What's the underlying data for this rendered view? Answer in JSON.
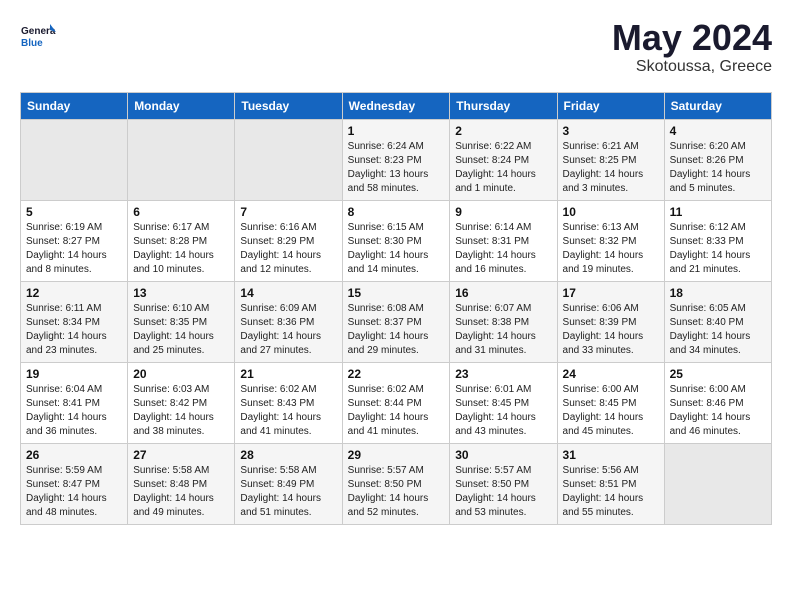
{
  "header": {
    "logo_line1": "General",
    "logo_line2": "Blue",
    "month_year": "May 2024",
    "location": "Skotoussa, Greece"
  },
  "days_of_week": [
    "Sunday",
    "Monday",
    "Tuesday",
    "Wednesday",
    "Thursday",
    "Friday",
    "Saturday"
  ],
  "weeks": [
    [
      {
        "day": "",
        "info": ""
      },
      {
        "day": "",
        "info": ""
      },
      {
        "day": "",
        "info": ""
      },
      {
        "day": "1",
        "info": "Sunrise: 6:24 AM\nSunset: 8:23 PM\nDaylight: 13 hours\nand 58 minutes."
      },
      {
        "day": "2",
        "info": "Sunrise: 6:22 AM\nSunset: 8:24 PM\nDaylight: 14 hours\nand 1 minute."
      },
      {
        "day": "3",
        "info": "Sunrise: 6:21 AM\nSunset: 8:25 PM\nDaylight: 14 hours\nand 3 minutes."
      },
      {
        "day": "4",
        "info": "Sunrise: 6:20 AM\nSunset: 8:26 PM\nDaylight: 14 hours\nand 5 minutes."
      }
    ],
    [
      {
        "day": "5",
        "info": "Sunrise: 6:19 AM\nSunset: 8:27 PM\nDaylight: 14 hours\nand 8 minutes."
      },
      {
        "day": "6",
        "info": "Sunrise: 6:17 AM\nSunset: 8:28 PM\nDaylight: 14 hours\nand 10 minutes."
      },
      {
        "day": "7",
        "info": "Sunrise: 6:16 AM\nSunset: 8:29 PM\nDaylight: 14 hours\nand 12 minutes."
      },
      {
        "day": "8",
        "info": "Sunrise: 6:15 AM\nSunset: 8:30 PM\nDaylight: 14 hours\nand 14 minutes."
      },
      {
        "day": "9",
        "info": "Sunrise: 6:14 AM\nSunset: 8:31 PM\nDaylight: 14 hours\nand 16 minutes."
      },
      {
        "day": "10",
        "info": "Sunrise: 6:13 AM\nSunset: 8:32 PM\nDaylight: 14 hours\nand 19 minutes."
      },
      {
        "day": "11",
        "info": "Sunrise: 6:12 AM\nSunset: 8:33 PM\nDaylight: 14 hours\nand 21 minutes."
      }
    ],
    [
      {
        "day": "12",
        "info": "Sunrise: 6:11 AM\nSunset: 8:34 PM\nDaylight: 14 hours\nand 23 minutes."
      },
      {
        "day": "13",
        "info": "Sunrise: 6:10 AM\nSunset: 8:35 PM\nDaylight: 14 hours\nand 25 minutes."
      },
      {
        "day": "14",
        "info": "Sunrise: 6:09 AM\nSunset: 8:36 PM\nDaylight: 14 hours\nand 27 minutes."
      },
      {
        "day": "15",
        "info": "Sunrise: 6:08 AM\nSunset: 8:37 PM\nDaylight: 14 hours\nand 29 minutes."
      },
      {
        "day": "16",
        "info": "Sunrise: 6:07 AM\nSunset: 8:38 PM\nDaylight: 14 hours\nand 31 minutes."
      },
      {
        "day": "17",
        "info": "Sunrise: 6:06 AM\nSunset: 8:39 PM\nDaylight: 14 hours\nand 33 minutes."
      },
      {
        "day": "18",
        "info": "Sunrise: 6:05 AM\nSunset: 8:40 PM\nDaylight: 14 hours\nand 34 minutes."
      }
    ],
    [
      {
        "day": "19",
        "info": "Sunrise: 6:04 AM\nSunset: 8:41 PM\nDaylight: 14 hours\nand 36 minutes."
      },
      {
        "day": "20",
        "info": "Sunrise: 6:03 AM\nSunset: 8:42 PM\nDaylight: 14 hours\nand 38 minutes."
      },
      {
        "day": "21",
        "info": "Sunrise: 6:02 AM\nSunset: 8:43 PM\nDaylight: 14 hours\nand 41 minutes."
      },
      {
        "day": "22",
        "info": "Sunrise: 6:02 AM\nSunset: 8:44 PM\nDaylight: 14 hours\nand 41 minutes."
      },
      {
        "day": "23",
        "info": "Sunrise: 6:01 AM\nSunset: 8:45 PM\nDaylight: 14 hours\nand 43 minutes."
      },
      {
        "day": "24",
        "info": "Sunrise: 6:00 AM\nSunset: 8:45 PM\nDaylight: 14 hours\nand 45 minutes."
      },
      {
        "day": "25",
        "info": "Sunrise: 6:00 AM\nSunset: 8:46 PM\nDaylight: 14 hours\nand 46 minutes."
      }
    ],
    [
      {
        "day": "26",
        "info": "Sunrise: 5:59 AM\nSunset: 8:47 PM\nDaylight: 14 hours\nand 48 minutes."
      },
      {
        "day": "27",
        "info": "Sunrise: 5:58 AM\nSunset: 8:48 PM\nDaylight: 14 hours\nand 49 minutes."
      },
      {
        "day": "28",
        "info": "Sunrise: 5:58 AM\nSunset: 8:49 PM\nDaylight: 14 hours\nand 51 minutes."
      },
      {
        "day": "29",
        "info": "Sunrise: 5:57 AM\nSunset: 8:50 PM\nDaylight: 14 hours\nand 52 minutes."
      },
      {
        "day": "30",
        "info": "Sunrise: 5:57 AM\nSunset: 8:50 PM\nDaylight: 14 hours\nand 53 minutes."
      },
      {
        "day": "31",
        "info": "Sunrise: 5:56 AM\nSunset: 8:51 PM\nDaylight: 14 hours\nand 55 minutes."
      },
      {
        "day": "",
        "info": ""
      }
    ]
  ]
}
